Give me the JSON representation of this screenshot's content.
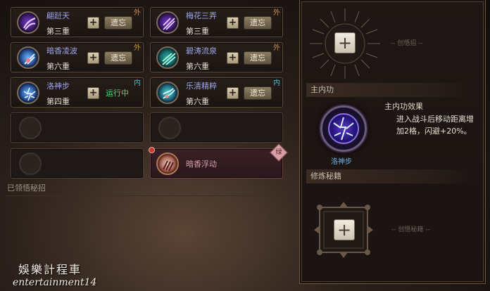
{
  "cards": [
    {
      "name": "翩跹天",
      "tier": "第三重",
      "action": "遗忘",
      "tag": "外",
      "icon": "purple-swirl-icon"
    },
    {
      "name": "梅花三弄",
      "tier": "第三重",
      "action": "遗忘",
      "tag": "外",
      "icon": "purple-blade-icon"
    },
    {
      "name": "暗香凌波",
      "tier": "第六重",
      "action": "遗忘",
      "tag": "外",
      "icon": "blue-strike-icon"
    },
    {
      "name": "碧涛流泉",
      "tier": "第六重",
      "action": "遗忘",
      "tag": "外",
      "icon": "teal-wave-icon"
    },
    {
      "name": "洛神步",
      "tier": "第四重",
      "status": "运行中",
      "tag": "内",
      "icon": "blue-lightning-icon"
    },
    {
      "name": "乐清精粹",
      "tier": "第六重",
      "action": "遗忘",
      "tag": "内",
      "icon": "cyan-flow-icon"
    }
  ],
  "hidden_art": {
    "name": "暗香浮动",
    "badge": "绿",
    "alert": "!"
  },
  "collected_label": "已领悟秘招",
  "right": {
    "top_hint": "-- 创悟招 --",
    "main_inner_header": "主内功",
    "main_inner_effect_title": "主内功效果",
    "main_inner_effect_text_1": "进入战斗后移动距离增",
    "main_inner_effect_text_2": "加2格，闪避+20%。",
    "main_inner_name": "洛神步",
    "secret_header": "修炼秘籍",
    "bottom_hint": "-- 创悟秘籍 --"
  },
  "watermark": {
    "line1": "娛樂計程車",
    "line2": "entertainment14"
  },
  "colors": {
    "accent_gold": "#c98a4d",
    "running_green": "#63d47a",
    "inner_blue": "#4fb7d6"
  }
}
